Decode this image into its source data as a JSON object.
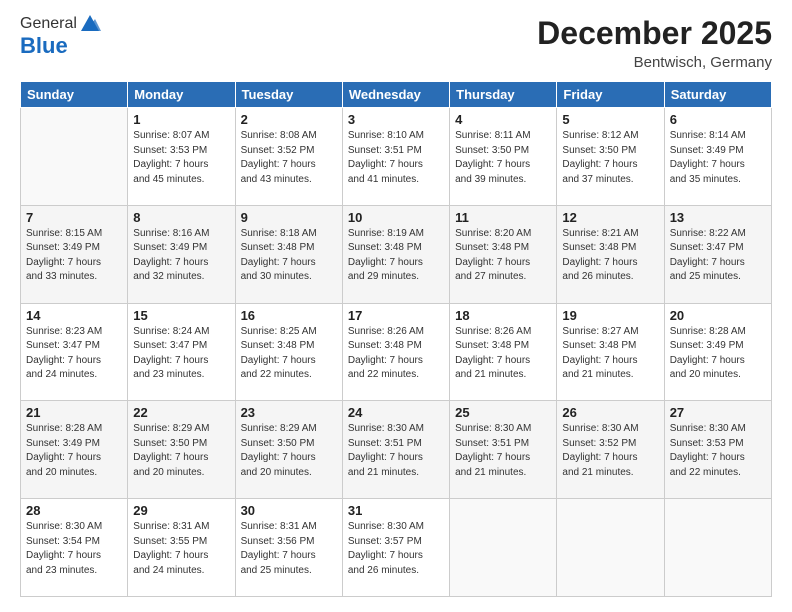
{
  "header": {
    "logo_general": "General",
    "logo_blue": "Blue",
    "month": "December 2025",
    "location": "Bentwisch, Germany"
  },
  "days_of_week": [
    "Sunday",
    "Monday",
    "Tuesday",
    "Wednesday",
    "Thursday",
    "Friday",
    "Saturday"
  ],
  "weeks": [
    [
      {
        "day": "",
        "sunrise": "",
        "sunset": "",
        "daylight": ""
      },
      {
        "day": "1",
        "sunrise": "Sunrise: 8:07 AM",
        "sunset": "Sunset: 3:53 PM",
        "daylight": "Daylight: 7 hours and 45 minutes."
      },
      {
        "day": "2",
        "sunrise": "Sunrise: 8:08 AM",
        "sunset": "Sunset: 3:52 PM",
        "daylight": "Daylight: 7 hours and 43 minutes."
      },
      {
        "day": "3",
        "sunrise": "Sunrise: 8:10 AM",
        "sunset": "Sunset: 3:51 PM",
        "daylight": "Daylight: 7 hours and 41 minutes."
      },
      {
        "day": "4",
        "sunrise": "Sunrise: 8:11 AM",
        "sunset": "Sunset: 3:50 PM",
        "daylight": "Daylight: 7 hours and 39 minutes."
      },
      {
        "day": "5",
        "sunrise": "Sunrise: 8:12 AM",
        "sunset": "Sunset: 3:50 PM",
        "daylight": "Daylight: 7 hours and 37 minutes."
      },
      {
        "day": "6",
        "sunrise": "Sunrise: 8:14 AM",
        "sunset": "Sunset: 3:49 PM",
        "daylight": "Daylight: 7 hours and 35 minutes."
      }
    ],
    [
      {
        "day": "7",
        "sunrise": "Sunrise: 8:15 AM",
        "sunset": "Sunset: 3:49 PM",
        "daylight": "Daylight: 7 hours and 33 minutes."
      },
      {
        "day": "8",
        "sunrise": "Sunrise: 8:16 AM",
        "sunset": "Sunset: 3:49 PM",
        "daylight": "Daylight: 7 hours and 32 minutes."
      },
      {
        "day": "9",
        "sunrise": "Sunrise: 8:18 AM",
        "sunset": "Sunset: 3:48 PM",
        "daylight": "Daylight: 7 hours and 30 minutes."
      },
      {
        "day": "10",
        "sunrise": "Sunrise: 8:19 AM",
        "sunset": "Sunset: 3:48 PM",
        "daylight": "Daylight: 7 hours and 29 minutes."
      },
      {
        "day": "11",
        "sunrise": "Sunrise: 8:20 AM",
        "sunset": "Sunset: 3:48 PM",
        "daylight": "Daylight: 7 hours and 27 minutes."
      },
      {
        "day": "12",
        "sunrise": "Sunrise: 8:21 AM",
        "sunset": "Sunset: 3:48 PM",
        "daylight": "Daylight: 7 hours and 26 minutes."
      },
      {
        "day": "13",
        "sunrise": "Sunrise: 8:22 AM",
        "sunset": "Sunset: 3:47 PM",
        "daylight": "Daylight: 7 hours and 25 minutes."
      }
    ],
    [
      {
        "day": "14",
        "sunrise": "Sunrise: 8:23 AM",
        "sunset": "Sunset: 3:47 PM",
        "daylight": "Daylight: 7 hours and 24 minutes."
      },
      {
        "day": "15",
        "sunrise": "Sunrise: 8:24 AM",
        "sunset": "Sunset: 3:47 PM",
        "daylight": "Daylight: 7 hours and 23 minutes."
      },
      {
        "day": "16",
        "sunrise": "Sunrise: 8:25 AM",
        "sunset": "Sunset: 3:48 PM",
        "daylight": "Daylight: 7 hours and 22 minutes."
      },
      {
        "day": "17",
        "sunrise": "Sunrise: 8:26 AM",
        "sunset": "Sunset: 3:48 PM",
        "daylight": "Daylight: 7 hours and 22 minutes."
      },
      {
        "day": "18",
        "sunrise": "Sunrise: 8:26 AM",
        "sunset": "Sunset: 3:48 PM",
        "daylight": "Daylight: 7 hours and 21 minutes."
      },
      {
        "day": "19",
        "sunrise": "Sunrise: 8:27 AM",
        "sunset": "Sunset: 3:48 PM",
        "daylight": "Daylight: 7 hours and 21 minutes."
      },
      {
        "day": "20",
        "sunrise": "Sunrise: 8:28 AM",
        "sunset": "Sunset: 3:49 PM",
        "daylight": "Daylight: 7 hours and 20 minutes."
      }
    ],
    [
      {
        "day": "21",
        "sunrise": "Sunrise: 8:28 AM",
        "sunset": "Sunset: 3:49 PM",
        "daylight": "Daylight: 7 hours and 20 minutes."
      },
      {
        "day": "22",
        "sunrise": "Sunrise: 8:29 AM",
        "sunset": "Sunset: 3:50 PM",
        "daylight": "Daylight: 7 hours and 20 minutes."
      },
      {
        "day": "23",
        "sunrise": "Sunrise: 8:29 AM",
        "sunset": "Sunset: 3:50 PM",
        "daylight": "Daylight: 7 hours and 20 minutes."
      },
      {
        "day": "24",
        "sunrise": "Sunrise: 8:30 AM",
        "sunset": "Sunset: 3:51 PM",
        "daylight": "Daylight: 7 hours and 21 minutes."
      },
      {
        "day": "25",
        "sunrise": "Sunrise: 8:30 AM",
        "sunset": "Sunset: 3:51 PM",
        "daylight": "Daylight: 7 hours and 21 minutes."
      },
      {
        "day": "26",
        "sunrise": "Sunrise: 8:30 AM",
        "sunset": "Sunset: 3:52 PM",
        "daylight": "Daylight: 7 hours and 21 minutes."
      },
      {
        "day": "27",
        "sunrise": "Sunrise: 8:30 AM",
        "sunset": "Sunset: 3:53 PM",
        "daylight": "Daylight: 7 hours and 22 minutes."
      }
    ],
    [
      {
        "day": "28",
        "sunrise": "Sunrise: 8:30 AM",
        "sunset": "Sunset: 3:54 PM",
        "daylight": "Daylight: 7 hours and 23 minutes."
      },
      {
        "day": "29",
        "sunrise": "Sunrise: 8:31 AM",
        "sunset": "Sunset: 3:55 PM",
        "daylight": "Daylight: 7 hours and 24 minutes."
      },
      {
        "day": "30",
        "sunrise": "Sunrise: 8:31 AM",
        "sunset": "Sunset: 3:56 PM",
        "daylight": "Daylight: 7 hours and 25 minutes."
      },
      {
        "day": "31",
        "sunrise": "Sunrise: 8:30 AM",
        "sunset": "Sunset: 3:57 PM",
        "daylight": "Daylight: 7 hours and 26 minutes."
      },
      {
        "day": "",
        "sunrise": "",
        "sunset": "",
        "daylight": ""
      },
      {
        "day": "",
        "sunrise": "",
        "sunset": "",
        "daylight": ""
      },
      {
        "day": "",
        "sunrise": "",
        "sunset": "",
        "daylight": ""
      }
    ]
  ],
  "row_shades": [
    "row-white",
    "row-shade",
    "row-white",
    "row-shade",
    "row-white"
  ]
}
